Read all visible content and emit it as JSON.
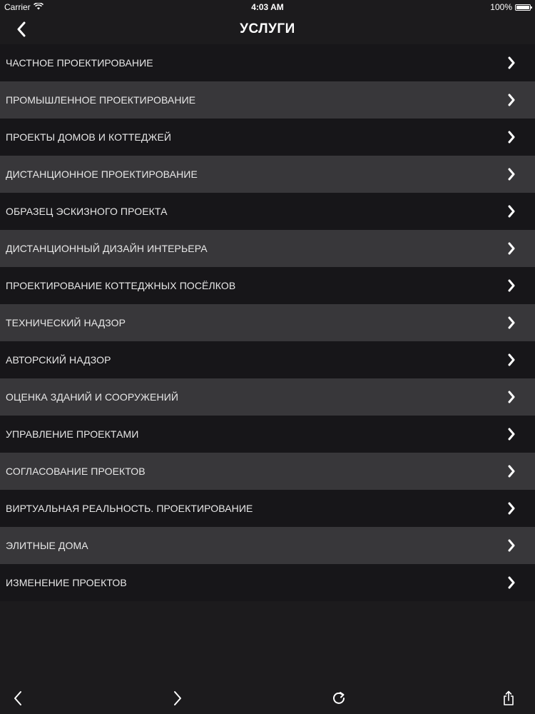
{
  "status_bar": {
    "carrier": "Carrier",
    "time": "4:03 AM",
    "battery": "100%",
    "battery_level": 1.0
  },
  "nav": {
    "title": "УСЛУГИ",
    "back_icon": "chevron-left-icon"
  },
  "services": [
    "ЧАСТНОЕ ПРОЕКТИРОВАНИЕ",
    "ПРОМЫШЛЕННОЕ ПРОЕКТИРОВАНИЕ",
    "ПРОЕКТЫ ДОМОВ И КОТТЕДЖЕЙ",
    "ДИСТАНЦИОННОЕ ПРОЕКТИРОВАНИЕ",
    "ОБРАЗЕЦ ЭСКИЗНОГО ПРОЕКТА",
    "ДИСТАНЦИОННЫЙ ДИЗАЙН ИНТЕРЬЕРА",
    "ПРОЕКТИРОВАНИЕ КОТТЕДЖНЫХ ПОСЁЛКОВ",
    "ТЕХНИЧЕСКИЙ НАДЗОР",
    "АВТОРСКИЙ НАДЗОР",
    "ОЦЕНКА ЗДАНИЙ И СООРУЖЕНИЙ",
    "УПРАВЛЕНИЕ ПРОЕКТАМИ",
    "СОГЛАСОВАНИЕ ПРОЕКТОВ",
    "ВИРТУАЛЬНАЯ РЕАЛЬНОСТЬ. ПРОЕКТИРОВАНИЕ",
    "ЭЛИТНЫЕ ДОМА",
    "ИЗМЕНЕНИЕ ПРОЕКТОВ"
  ],
  "toolbar": {
    "back_icon": "arrow-back-icon",
    "forward_icon": "arrow-forward-icon",
    "reload_icon": "reload-icon",
    "share_icon": "share-icon"
  },
  "colors": {
    "background": "#1c1b1d",
    "row_dark": "#171619",
    "row_light": "#38373a",
    "text": "#e8e8e8"
  }
}
